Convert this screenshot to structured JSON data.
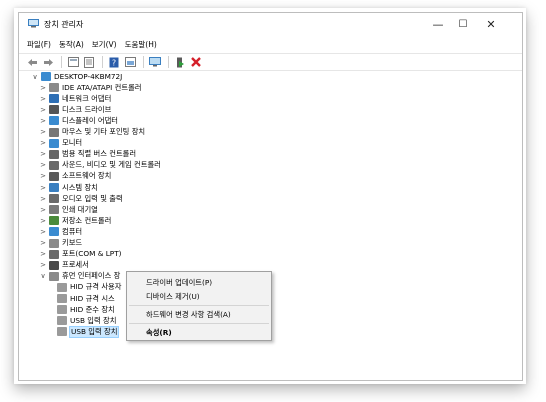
{
  "window": {
    "title": "장치 관리자",
    "controls": [
      "—",
      "☐",
      "✕"
    ]
  },
  "menu": [
    "파일(F)",
    "동작(A)",
    "보기(V)",
    "도움말(H)"
  ],
  "toolbar": {
    "icons": [
      "back-icon",
      "forward-icon",
      "view-icon",
      "properties-icon",
      "help-icon",
      "update-driver-icon",
      "monitor-icon",
      "enable-icon",
      "uninstall-icon"
    ],
    "accent_green": "#2e9e3a",
    "accent_red": "#d4202a"
  },
  "tree": {
    "root": "DESKTOP-4KBM72J",
    "categories": [
      {
        "label": "IDE ATA/ATAPI 컨트롤러",
        "icon": "ide-icon",
        "color": "#8a8a8a"
      },
      {
        "label": "네트워크 어댑터",
        "icon": "network-icon",
        "color": "#2e6fb5"
      },
      {
        "label": "디스크 드라이브",
        "icon": "disk-icon",
        "color": "#555555"
      },
      {
        "label": "디스플레이 어댑터",
        "icon": "display-icon",
        "color": "#3a8bd0"
      },
      {
        "label": "마우스 및 기타 포인팅 장치",
        "icon": "mouse-icon",
        "color": "#777777"
      },
      {
        "label": "모니터",
        "icon": "monitor-icon",
        "color": "#3a8bd0"
      },
      {
        "label": "범용 직렬 버스 컨트롤러",
        "icon": "usb-icon",
        "color": "#666666"
      },
      {
        "label": "사운드, 비디오 및 게임 컨트롤러",
        "icon": "sound-icon",
        "color": "#6a6a6a"
      },
      {
        "label": "소프트웨어 장치",
        "icon": "software-icon",
        "color": "#5a5a5a"
      },
      {
        "label": "시스템 장치",
        "icon": "system-icon",
        "color": "#3a7fc0"
      },
      {
        "label": "오디오 입력 및 출력",
        "icon": "audio-icon",
        "color": "#6a6a6a"
      },
      {
        "label": "인쇄 대기열",
        "icon": "printer-icon",
        "color": "#7a7a7a"
      },
      {
        "label": "저장소 컨트롤러",
        "icon": "storage-icon",
        "color": "#4a8a3a"
      },
      {
        "label": "컴퓨터",
        "icon": "computer-icon",
        "color": "#3a8bd0"
      },
      {
        "label": "키보드",
        "icon": "keyboard-icon",
        "color": "#8a8a8a"
      },
      {
        "label": "포트(COM & LPT)",
        "icon": "port-icon",
        "color": "#6a6a6a"
      },
      {
        "label": "프로세서",
        "icon": "processor-icon",
        "color": "#4a4a4a"
      }
    ],
    "expanded": {
      "label": "휴먼 인터페이스 장",
      "icon": "hid-icon",
      "children": [
        "HID 규격 사용자",
        "HID 규격 시스",
        "HID 준수 장치",
        "USB 입력 장치",
        "USB 입력 장치"
      ]
    }
  },
  "context_menu": {
    "items": [
      "드라이버 업데이트(P)",
      "디바이스 제거(U)",
      "하드웨어 변경 사항 검색(A)",
      "속성(R)"
    ]
  }
}
